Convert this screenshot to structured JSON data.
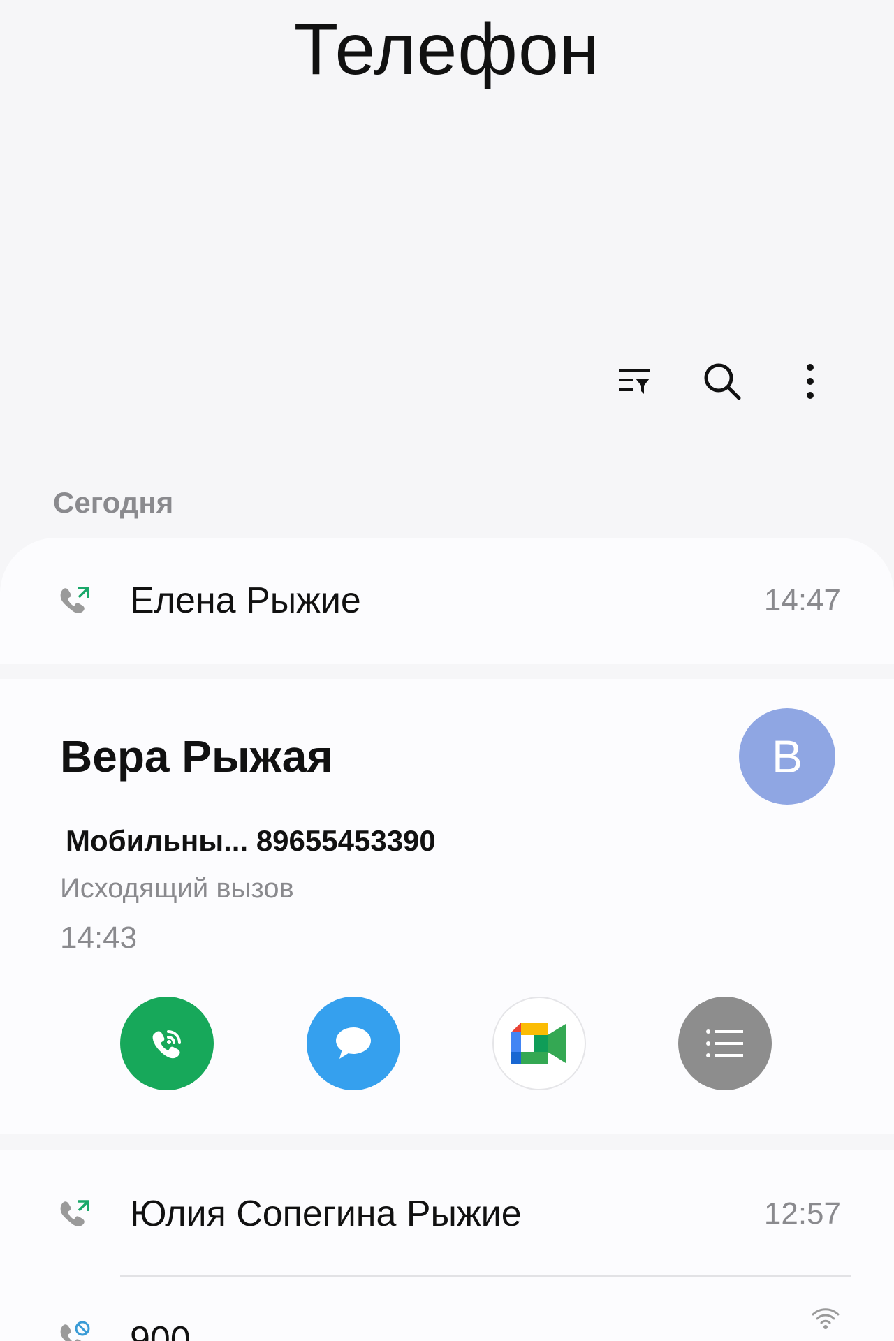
{
  "app": {
    "title": "Телефон"
  },
  "toolbar": {
    "icons": [
      "filter-icon",
      "search-icon",
      "more-icon"
    ]
  },
  "section": {
    "today_label": "Сегодня"
  },
  "calls": [
    {
      "name": "Елена Рыжие",
      "time": "14:47",
      "icon": "outgoing-call-icon"
    },
    {
      "name": "Юлия Сопегина Рыжие",
      "time": "12:57",
      "icon": "outgoing-call-icon"
    },
    {
      "name": "900",
      "time": "",
      "icon": "blocked-call-icon"
    }
  ],
  "expanded": {
    "name": "Вера Рыжая",
    "avatar_letter": "В",
    "avatar_color": "#8fa6e3",
    "phone_label": "Мобильны...",
    "phone_number": "89655453390",
    "call_type": "Исходящий вызов",
    "time": "14:43",
    "actions": [
      {
        "name": "wifi-call-button",
        "icon": "wifi-call-icon",
        "color": "#17a85a"
      },
      {
        "name": "message-button",
        "icon": "message-icon",
        "color": "#35a0ee"
      },
      {
        "name": "video-call-button",
        "icon": "google-meet-icon",
        "color": "#ffffff"
      },
      {
        "name": "details-button",
        "icon": "list-icon",
        "color": "#8d8d8d"
      }
    ]
  }
}
